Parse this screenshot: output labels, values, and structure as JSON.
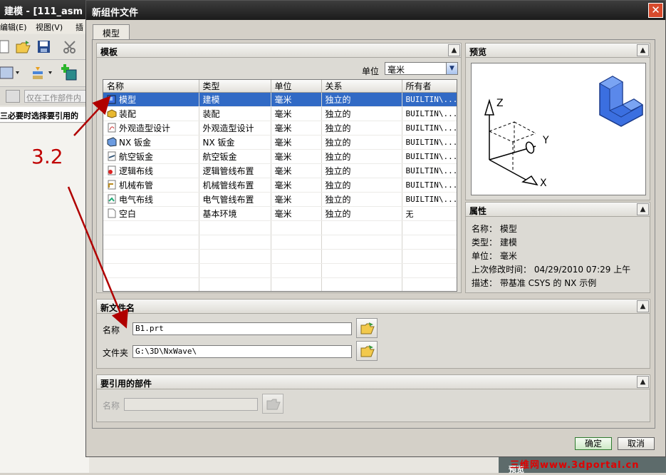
{
  "background_app": {
    "title": "建模 - [111_asm",
    "menu": [
      "编辑(E)",
      "视图(V)",
      "插"
    ],
    "filter_placeholder": "仅在工作部件内",
    "hint": "三必要时选择要引用的",
    "annotation": "3.2",
    "bottom_label": "预览"
  },
  "watermark": "三维网www.3dportal.cn",
  "dialog": {
    "title": "新组件文件",
    "close_glyph": "✕",
    "tab": "模型"
  },
  "templates": {
    "header": "模板",
    "units_label": "单位",
    "units_value": "毫米",
    "columns": [
      "名称",
      "类型",
      "单位",
      "关系",
      "所有者"
    ],
    "rows": [
      {
        "name": "模型",
        "type": "建模",
        "unit": "毫米",
        "relation": "独立的",
        "owner": "BUILTIN\\...",
        "icon": "model-icon",
        "selected": true
      },
      {
        "name": "装配",
        "type": "装配",
        "unit": "毫米",
        "relation": "独立的",
        "owner": "BUILTIN\\...",
        "icon": "assembly-icon"
      },
      {
        "name": "外观造型设计",
        "type": "外观造型设计",
        "unit": "毫米",
        "relation": "独立的",
        "owner": "BUILTIN\\...",
        "icon": "shape-studio-icon"
      },
      {
        "name": "NX 钣金",
        "type": "NX 钣金",
        "unit": "毫米",
        "relation": "独立的",
        "owner": "BUILTIN\\...",
        "icon": "sheet-metal-icon"
      },
      {
        "name": "航空钣金",
        "type": "航空钣金",
        "unit": "毫米",
        "relation": "独立的",
        "owner": "BUILTIN\\...",
        "icon": "aero-sheet-metal-icon"
      },
      {
        "name": "逻辑布线",
        "type": "逻辑管线布置",
        "unit": "毫米",
        "relation": "独立的",
        "owner": "BUILTIN\\...",
        "icon": "logical-routing-icon"
      },
      {
        "name": "机械布管",
        "type": "机械管线布置",
        "unit": "毫米",
        "relation": "独立的",
        "owner": "BUILTIN\\...",
        "icon": "mechanical-routing-icon"
      },
      {
        "name": "电气布线",
        "type": "电气管线布置",
        "unit": "毫米",
        "relation": "独立的",
        "owner": "BUILTIN\\...",
        "icon": "electrical-routing-icon"
      },
      {
        "name": "空白",
        "type": "基本环境",
        "unit": "毫米",
        "relation": "独立的",
        "owner": "无",
        "icon": "blank-icon"
      }
    ]
  },
  "preview": {
    "header": "预览",
    "axis_labels": {
      "z": "Z",
      "y": "Y",
      "x": "X"
    }
  },
  "properties": {
    "header": "属性",
    "lines": [
      "名称： 模型",
      "类型： 建模",
      "单位： 毫米",
      "上次修改时间： 04/29/2010 07:29 上午",
      "描述： 带基准 CSYS 的 NX 示例"
    ]
  },
  "new_file": {
    "header": "新文件名",
    "name_label": "名称",
    "name_value": "B1.prt",
    "folder_label": "文件夹",
    "folder_value": "G:\\3D\\NxWave\\"
  },
  "referenced_parts": {
    "header": "要引用的部件",
    "name_label": "名称",
    "name_value": ""
  },
  "buttons": {
    "ok": "确定",
    "cancel": "取消"
  },
  "colors": {
    "selection": "#316ac5",
    "annotation": "#c00000",
    "close_button": "#d84a2c"
  }
}
